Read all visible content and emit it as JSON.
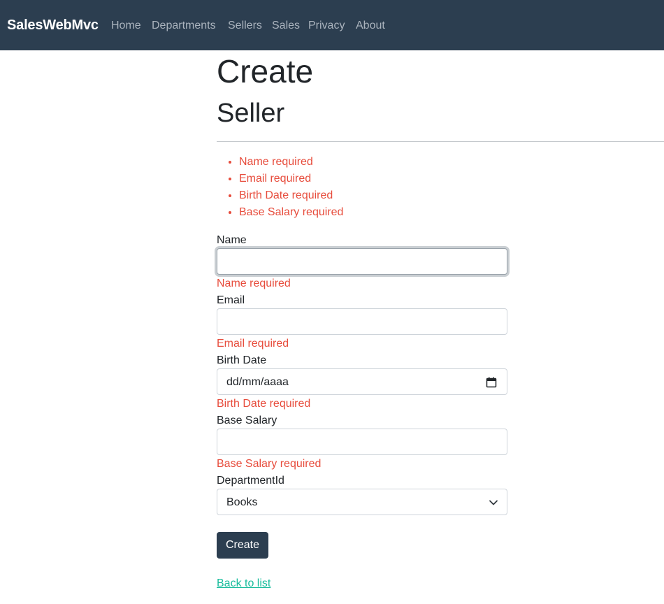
{
  "navbar": {
    "brand": "SalesWebMvc",
    "links": [
      "Home",
      "Departments",
      "Sellers",
      "Sales",
      "Privacy",
      "About"
    ]
  },
  "page": {
    "title": "Create",
    "subtitle": "Seller"
  },
  "validation_summary": [
    "Name required",
    "Email required",
    "Birth Date required",
    "Base Salary required"
  ],
  "form": {
    "name": {
      "label": "Name",
      "value": "",
      "error": "Name required"
    },
    "email": {
      "label": "Email",
      "value": "",
      "error": "Email required"
    },
    "birth_date": {
      "label": "Birth Date",
      "placeholder": "dd/mm/aaaa",
      "error": "Birth Date required"
    },
    "base_salary": {
      "label": "Base Salary",
      "value": "",
      "error": "Base Salary required"
    },
    "department": {
      "label": "DepartmentId",
      "selected": "Books"
    },
    "submit_label": "Create",
    "back_link": "Back to list"
  },
  "colors": {
    "navbar_bg": "#2c3e50",
    "error": "#e74c3c",
    "link": "#18bc9c",
    "button_bg": "#2c3e50"
  }
}
